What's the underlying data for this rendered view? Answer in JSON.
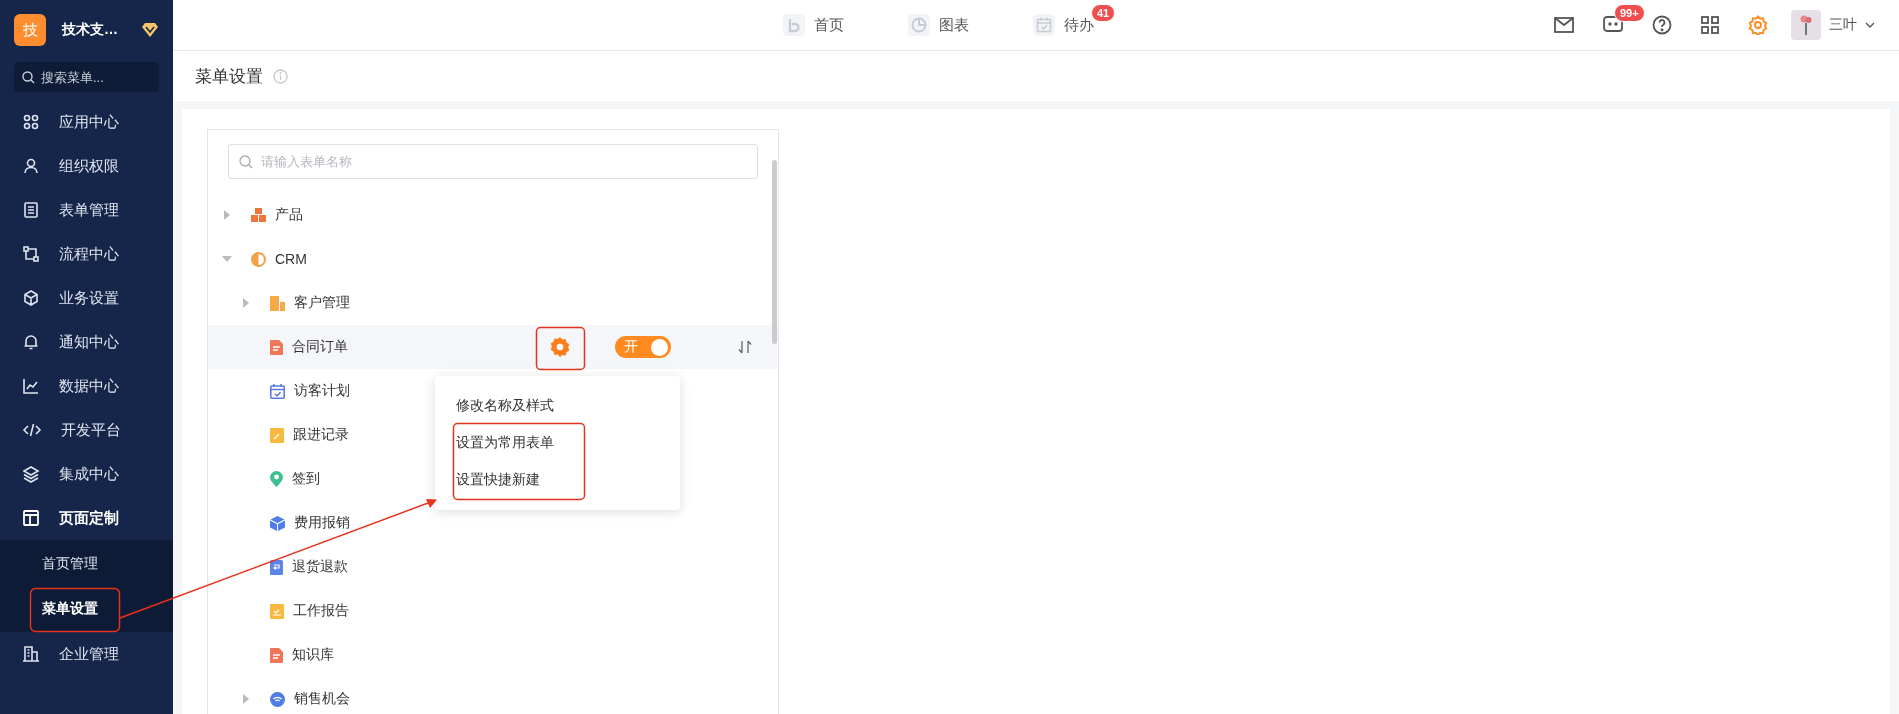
{
  "sidebar": {
    "logo": "技",
    "org_name": "技术支…",
    "search": {
      "placeholder": "搜索菜单..."
    },
    "items": [
      {
        "label": "应用中心",
        "expanded": false
      },
      {
        "label": "组织权限",
        "expanded": false
      },
      {
        "label": "表单管理",
        "expanded": false
      },
      {
        "label": "流程中心",
        "expanded": false
      },
      {
        "label": "业务设置",
        "expanded": false
      },
      {
        "label": "通知中心",
        "expanded": false
      },
      {
        "label": "数据中心",
        "expanded": false
      },
      {
        "label": "开发平台",
        "expanded": false
      },
      {
        "label": "集成中心",
        "expanded": false
      },
      {
        "label": "页面定制",
        "expanded": true,
        "children": [
          {
            "label": "首页管理",
            "selected": false
          },
          {
            "label": "菜单设置",
            "selected": true
          }
        ]
      },
      {
        "label": "企业管理",
        "expanded": false
      }
    ]
  },
  "top_nav": [
    {
      "label": "首页"
    },
    {
      "label": "图表"
    },
    {
      "label": "待办",
      "badge": "41"
    }
  ],
  "toolbar": {
    "message_badge": "99+",
    "user_name": "三叶"
  },
  "page_title": "菜单设置",
  "form_tree": {
    "search": {
      "placeholder": "请输入表单名称"
    },
    "nodes": [
      {
        "label": "产品",
        "color": "#f0743e",
        "expanded": false
      },
      {
        "label": "CRM",
        "color": "#f5a04a",
        "expanded": true,
        "children": [
          {
            "label": "客户管理",
            "color": "#f5a947",
            "expanded": false
          },
          {
            "label": "合同订单",
            "color": "#ef7656",
            "hovered": true,
            "toggle": {
              "label": "开",
              "on": true
            }
          },
          {
            "label": "访客计划",
            "color": "#5b7be8"
          },
          {
            "label": "跟进记录",
            "color": "#f9b93f"
          },
          {
            "label": "签到",
            "color": "#3dbf8f"
          },
          {
            "label": "费用报销",
            "color": "#4f7fe6"
          },
          {
            "label": "退货退款",
            "color": "#5b84e8"
          },
          {
            "label": "工作报告",
            "color": "#f9b93f"
          },
          {
            "label": "知识库",
            "color": "#ef7656"
          },
          {
            "label": "销售机会",
            "color": "#4f7fe6",
            "expanded": false
          }
        ]
      }
    ]
  },
  "context_menu": {
    "items": [
      "修改名称及样式",
      "设置为常用表单",
      "设置快捷新建"
    ]
  }
}
